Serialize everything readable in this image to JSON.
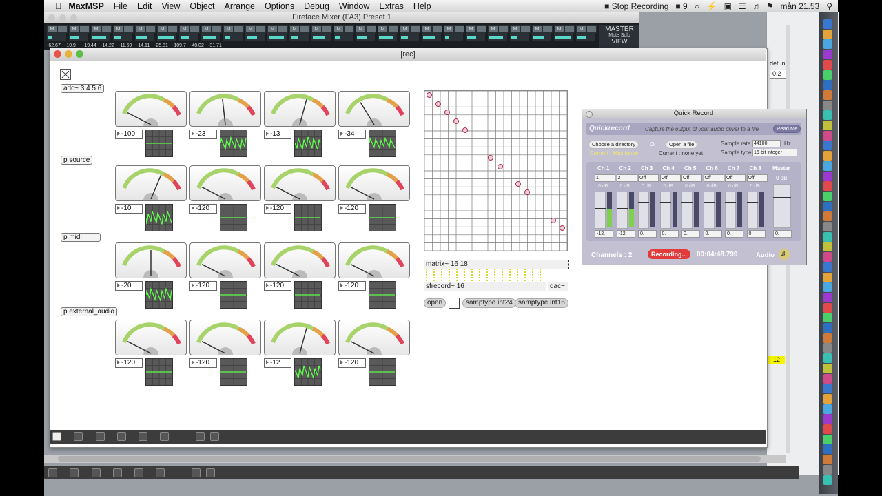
{
  "menubar": {
    "app_name": "MaxMSP",
    "items": [
      "File",
      "Edit",
      "View",
      "Object",
      "Arrange",
      "Options",
      "Debug",
      "Window",
      "Extras",
      "Help"
    ],
    "stop_recording": "Stop Recording",
    "status": "9",
    "clock": "mån 21.53"
  },
  "fireface": {
    "title": "Fireface Mixer (FA3) Preset 1",
    "channel_button": "M",
    "values": [
      "-62.67",
      "-10.9",
      "-19.44",
      "-14.22",
      "-11.69",
      "-14.11",
      "-25.81",
      "-109.7",
      "-40.02",
      "-31.71"
    ],
    "master_label": "MASTER",
    "mute_label": "Mute",
    "solo_label": "Solo",
    "view_label": "VIEW"
  },
  "right_window": {
    "detune_label": "detun",
    "detune_value": "-0.2",
    "yellow_value": "12"
  },
  "rec": {
    "title": "[rec]",
    "adc_object": "adc~ 3 4 5 6",
    "subpatches": [
      "p source",
      "p midi",
      "p external_audio"
    ],
    "meter_values": [
      [
        "-100",
        "-23",
        "-13",
        "-34"
      ],
      [
        "-10",
        "-120",
        "-120",
        "-120"
      ],
      [
        "-20",
        "-120",
        "-120",
        "-120"
      ],
      [
        "-120",
        "-120",
        "-12",
        "-120"
      ]
    ],
    "meter_levels": [
      [
        0.0,
        0.45,
        0.62,
        0.25
      ],
      [
        0.68,
        0.0,
        0.0,
        0.0
      ],
      [
        0.5,
        0.0,
        0.0,
        0.0
      ],
      [
        0.0,
        0.0,
        0.62,
        0.0
      ]
    ],
    "matrix_object": "matrix~ 16 18",
    "sfrecord_object": "sfrecord~ 16",
    "dac_object": "dac~",
    "open_button": "open",
    "samptype_24": "samptype int24",
    "samptype_16": "samptype int16"
  },
  "quickrecord": {
    "window_title": "Quick Record",
    "brand": "Quickrecord",
    "tagline": "Capture the output of your audio driver to a file",
    "read_me": "Read Me",
    "choose_directory": "Choose a directory",
    "or": "Or",
    "open_file": "Open a file",
    "current_folder": "Current : Max folder",
    "current_file": "Current : none yet",
    "sample_rate_label": "Sample rate",
    "sample_rate": "44100",
    "hz": "Hz",
    "sample_type_label": "Sample type",
    "sample_type": "16-bit integer",
    "channels": [
      {
        "name": "Ch 1",
        "sel": "1",
        "db": "0 dB",
        "val": "-12."
      },
      {
        "name": "Ch 2",
        "sel": "2",
        "db": "0 dB",
        "val": "-12."
      },
      {
        "name": "Ch 3",
        "sel": "Off",
        "db": "0 dB",
        "val": "0."
      },
      {
        "name": "Ch 4",
        "sel": "Off",
        "db": "0 dB",
        "val": "0."
      },
      {
        "name": "Ch 5",
        "sel": "Off",
        "db": "0 dB",
        "val": "0."
      },
      {
        "name": "Ch 6",
        "sel": "Off",
        "db": "0 dB",
        "val": "0."
      },
      {
        "name": "Ch 7",
        "sel": "Off",
        "db": "0 dB",
        "val": "0."
      },
      {
        "name": "Ch 8",
        "sel": "Off",
        "db": "0 dB",
        "val": "0."
      }
    ],
    "master_label": "Master",
    "master_db": "0 dB",
    "master_val": "0.",
    "channels_count": "Channels : 2",
    "recording": "Recording...",
    "time": "00:04:48.799",
    "audio_label": "Audio"
  },
  "colors": {
    "meter_green": "#8fd14f",
    "meter_red": "#e0435a",
    "scope_bg": "#595959",
    "recording_red": "#e23b3b",
    "quick_record_bg": "#c3c1d1"
  }
}
